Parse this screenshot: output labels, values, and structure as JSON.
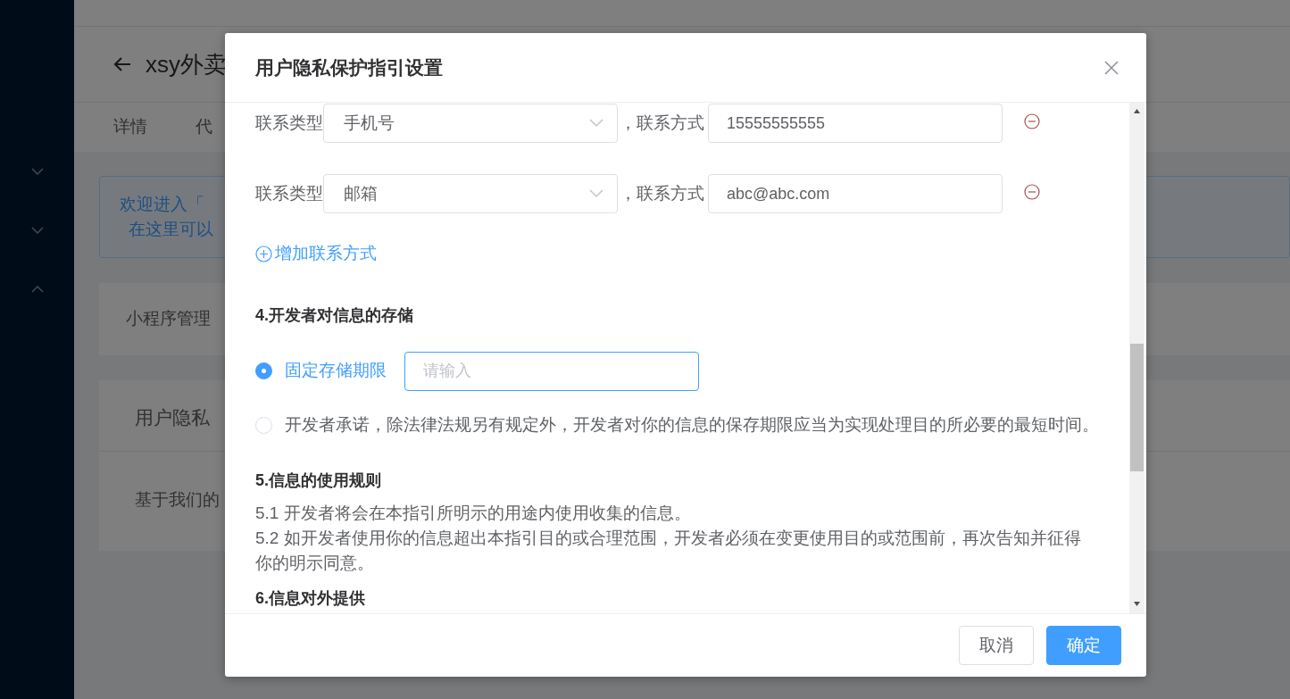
{
  "sidebar": {
    "menu_toggles": [
      {
        "expanded": false
      },
      {
        "expanded": false
      },
      {
        "expanded": true
      }
    ]
  },
  "page": {
    "title": "xsy外卖",
    "tabs": [
      "详情",
      "代"
    ],
    "notice": [
      "欢迎进入「",
      "在这里可以"
    ],
    "card_1": "小程序管理",
    "card_2": {
      "header": "用户隐私",
      "body": "基于我们的"
    }
  },
  "dialog": {
    "title": "用户隐私保护指引设置",
    "contacts": [
      {
        "type_label": "联系类型",
        "type": "手机号",
        "method_label": "，联系方式",
        "value": "15555555555"
      },
      {
        "type_label": "联系类型",
        "type": "邮箱",
        "method_label": "，联系方式",
        "value": "abc@abc.com"
      }
    ],
    "add_contact": "增加联系方式",
    "storage": {
      "heading": "4.开发者对信息的存储",
      "options": [
        {
          "kind": "input",
          "label": "固定存储期限",
          "selected": true,
          "placeholder": "请输入"
        },
        {
          "kind": "text",
          "label": "开发者承诺，除法律法规另有规定外，开发者对你的信息的保存期限应当为实现处理目的所必要的最短时间。",
          "selected": false
        }
      ]
    },
    "usage": {
      "heading": "5.信息的使用规则",
      "lines": [
        "5.1 开发者将会在本指引所明示的用途内使用收集的信息。",
        "5.2 如开发者使用你的信息超出本指引目的或合理范围，开发者必须在变更使用目的或范围前，再次告知并征得你的明示同意。"
      ]
    },
    "next_heading": "6.信息对外提供",
    "buttons": [
      {
        "kind": "default",
        "label": "取消"
      },
      {
        "kind": "primary",
        "label": "确定"
      }
    ]
  }
}
